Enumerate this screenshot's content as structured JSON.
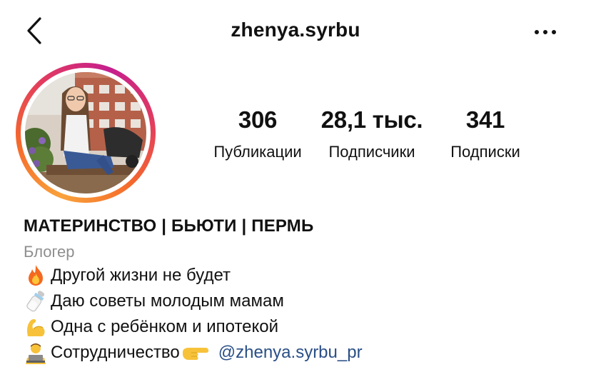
{
  "header": {
    "username": "zhenya.syrbu",
    "back_icon": "chevron-left-icon",
    "more_icon": "more-horizontal-icon"
  },
  "stats": [
    {
      "value": "306",
      "label": "Публикации"
    },
    {
      "value": "28,1 тыс.",
      "label": "Подписчики"
    },
    {
      "value": "341",
      "label": "Подписки"
    }
  ],
  "bio": {
    "name": "МАТЕРИНСТВО | БЬЮТИ | ПЕРМЬ",
    "category": "Блогер",
    "lines": [
      {
        "icon": "fire-icon",
        "text": "Другой жизни не будет"
      },
      {
        "icon": "baby-bottle-icon",
        "text": "Даю советы молодым мамам"
      },
      {
        "icon": "flexed-biceps-icon",
        "text": "Одна с ребёнком и ипотекой"
      },
      {
        "icon": "technologist-icon",
        "text": "Сотрудничество",
        "trailing_icon": "pointing-right-icon",
        "link": "@zhenya.syrbu_pr"
      }
    ]
  },
  "colors": {
    "text": "#111111",
    "category": "#8e8e8e",
    "link": "#2a4f87",
    "ring_start": "#f9a23b",
    "ring_end": "#c51f8e"
  }
}
